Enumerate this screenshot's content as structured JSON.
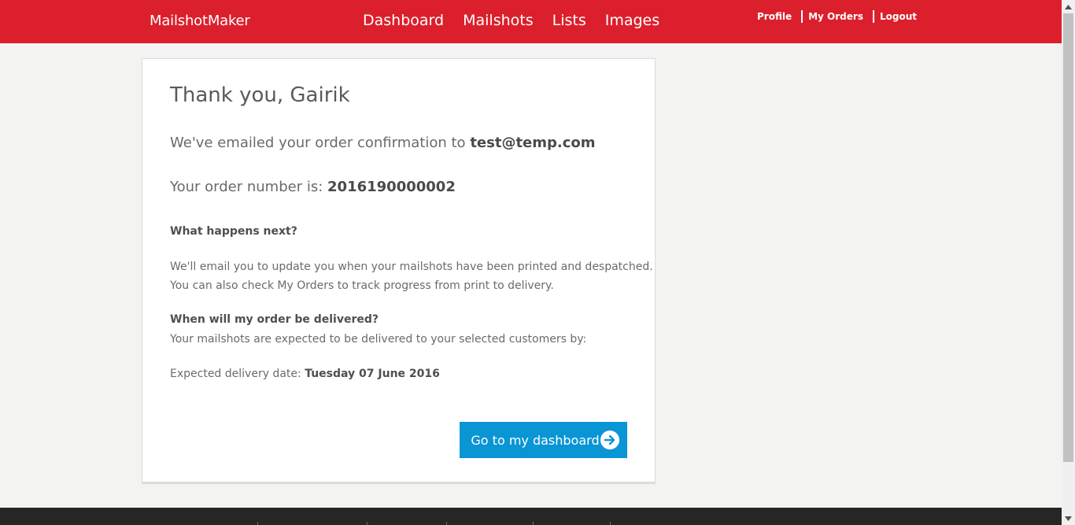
{
  "header": {
    "brand": "MailshotMaker",
    "nav": [
      "Dashboard",
      "Mailshots",
      "Lists",
      "Images"
    ],
    "user_links": [
      "Profile",
      "My Orders",
      "Logout"
    ],
    "accent_color": "#dc1f2c"
  },
  "confirmation": {
    "title": "Thank you, Gairik",
    "email_text": "We've emailed your order confirmation to",
    "email": "test@temp.com",
    "order_text": "Your order number is:",
    "order_number": "2016190000002",
    "next_heading": "What happens next?",
    "next_line1": "We'll email you to update you when your mailshots have been printed and despatched.",
    "next_line2": "You can also check My Orders to track progress from print to delivery.",
    "delivery_heading": "When will my order be delivered?",
    "delivery_text": "Your mailshots are expected to be delivered to your selected customers by:",
    "delivery_label": "Expected delivery date:",
    "delivery_date": "Tuesday 07 June 2016",
    "button_label": "Go to my dashboard",
    "button_icon": "arrow-right-circle-icon",
    "button_color": "#0a95d4"
  }
}
